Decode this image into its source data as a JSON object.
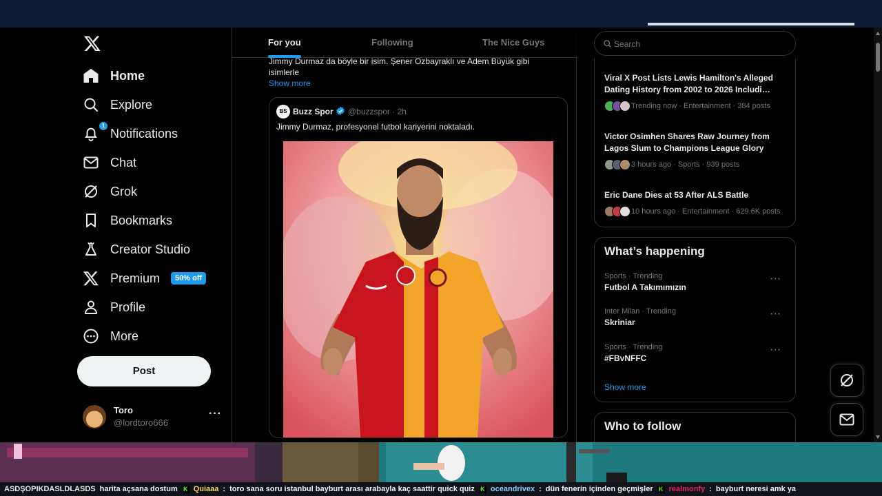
{
  "sidebar": {
    "items": [
      {
        "label": "Home",
        "icon": "home-icon"
      },
      {
        "label": "Explore",
        "icon": "search-icon"
      },
      {
        "label": "Notifications",
        "icon": "bell-icon",
        "badge": "1"
      },
      {
        "label": "Chat",
        "icon": "mail-icon"
      },
      {
        "label": "Grok",
        "icon": "grok-icon"
      },
      {
        "label": "Bookmarks",
        "icon": "bookmark-icon"
      },
      {
        "label": "Creator Studio",
        "icon": "flask-icon"
      },
      {
        "label": "Premium",
        "icon": "x-logo-icon",
        "badge": "50% off"
      },
      {
        "label": "Profile",
        "icon": "person-icon"
      },
      {
        "label": "More",
        "icon": "more-circle-icon"
      }
    ],
    "post_label": "Post",
    "account": {
      "name": "Toro",
      "handle": "@lordtoro666"
    }
  },
  "feed": {
    "tabs": [
      "For you",
      "Following",
      "The Nice Guys"
    ],
    "active_tab": "For you",
    "tweet_text": "Jimmy Durmaz da böyle bir isim. Şener Özbayraklı ve Adem Büyük gibi isimlerle",
    "show_more": "Show more",
    "quote": {
      "avatar_text": "BS",
      "name": "Buzz Spor",
      "handle": "@buzzspor · 2h",
      "text": "Jimmy Durmaz, profesyonel futbol kariyerini noktaladı."
    }
  },
  "right": {
    "search_placeholder": "Search",
    "news": [
      {
        "title": "Viral X Post Lists Lewis Hamilton's Alleged Dating History from 2002 to 2026 Includi…",
        "meta": "Trending now · Entertainment · 384 posts"
      },
      {
        "title": "Victor Osimhen Shares Raw Journey from Lagos Slum to Champions League Glory",
        "meta": "3 hours ago · Sports · 939 posts"
      },
      {
        "title": "Eric Dane Dies at 53 After ALS Battle",
        "meta": "10 hours ago · Entertainment · 629.6K posts"
      }
    ],
    "happening": {
      "title": "What’s happening",
      "trends": [
        {
          "meta": "Sports · Trending",
          "name": "Futbol A Takımımızın"
        },
        {
          "meta": "Inter Milan · Trending",
          "name": "Skriniar"
        },
        {
          "meta": "Sports · Trending",
          "name": "#FBvNFFC"
        }
      ],
      "show_more": "Show more"
    },
    "who_to_follow": "Who to follow"
  },
  "chat": [
    {
      "user": "ASDŞOPIKDASLDLASDS",
      "message": "harita açsana dostum",
      "color": "#eaeaea"
    },
    {
      "user": "Quiaaa",
      "message": "toro sana soru istanbul bayburt arası arabayla kaç saattir  quick quiz",
      "color": "#f6d55c"
    },
    {
      "user": "oceandrivex",
      "message": "dün fenerin içinden geçmişler",
      "color": "#7fd1ff"
    },
    {
      "user": "realmonfy",
      "message": "bayburt neresi amk ya",
      "color": "#e0245e"
    }
  ],
  "colors": {
    "accent": "#1d9bf0",
    "background": "#000000",
    "border": "#2f3336",
    "muted": "#71767b"
  }
}
